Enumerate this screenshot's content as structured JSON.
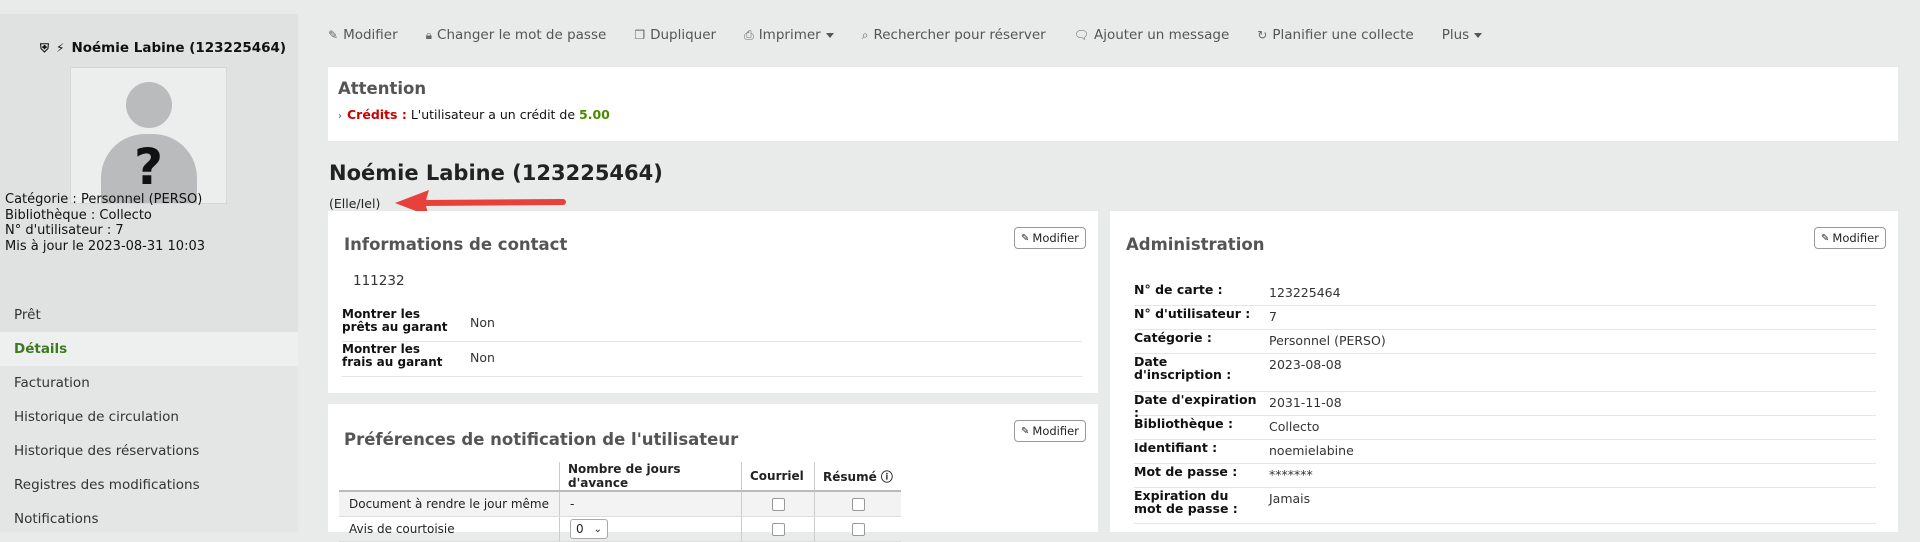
{
  "sidebar": {
    "patron_name": "Noémie Labine (123225464)",
    "info": [
      "Catégorie : Personnel (PERSO)",
      "Bibliothèque : Collecto",
      "N° d'utilisateur : 7",
      "Mis à jour le 2023-08-31 10:03"
    ],
    "nav": [
      "Prêt",
      "Détails",
      "Facturation",
      "Historique de circulation",
      "Historique des réservations",
      "Registres des modifications",
      "Notifications"
    ],
    "active_nav": "Détails"
  },
  "toolbar": {
    "items": [
      {
        "label": "Modifier",
        "icon": "pencil-icon"
      },
      {
        "label": "Changer le mot de passe",
        "icon": "lock-icon"
      },
      {
        "label": "Dupliquer",
        "icon": "copy-icon"
      },
      {
        "label": "Imprimer",
        "icon": "print-icon",
        "dropdown": true
      },
      {
        "label": "Rechercher pour réserver",
        "icon": "search-icon"
      },
      {
        "label": "Ajouter un message",
        "icon": "comment-icon"
      },
      {
        "label": "Planifier une collecte",
        "icon": "refresh-icon"
      },
      {
        "label": "Plus",
        "dropdown": true
      }
    ]
  },
  "attention": {
    "title": "Attention",
    "credit_label": "Crédits :",
    "credit_text": "L'utilisateur a un crédit de",
    "credit_value": "5.00"
  },
  "patron": {
    "heading": "Noémie Labine (123225464)",
    "pronouns": "(Elle/Iel)"
  },
  "contact": {
    "title": "Informations de contact",
    "edit_label": "Modifier",
    "phone": "111232",
    "rows": [
      {
        "key": "Montrer les prêts au garant",
        "value": "Non"
      },
      {
        "key": "Montrer les frais au garant",
        "value": "Non"
      }
    ]
  },
  "notifications": {
    "title": "Préférences de notification de l'utilisateur",
    "edit_label": "Modifier",
    "headers": [
      "",
      "Nombre de jours d'avance",
      "Courriel",
      "Résumé"
    ],
    "rows": [
      {
        "label": "Document à rendre le jour même",
        "days": "-"
      },
      {
        "label": "Avis de courtoisie",
        "days": "0"
      }
    ]
  },
  "admin": {
    "title": "Administration",
    "edit_label": "Modifier",
    "rows": [
      {
        "key": "N° de carte :",
        "value": "123225464"
      },
      {
        "key": "N° d'utilisateur :",
        "value": "7"
      },
      {
        "key": "Catégorie :",
        "value": "Personnel (PERSO)"
      },
      {
        "key": "Date d'inscription :",
        "value": "2023-08-08"
      },
      {
        "key": "Date d'expiration :",
        "value": "2031-11-08"
      },
      {
        "key": "Bibliothèque :",
        "value": "Collecto"
      },
      {
        "key": "Identifiant :",
        "value": "noemielabine"
      },
      {
        "key": "Mot de passe :",
        "value": "*******"
      },
      {
        "key": "Expiration du mot de passe :",
        "value": "Jamais"
      }
    ]
  },
  "colors": {
    "accent_green": "#3d7a22",
    "credit_red": "#cc0000",
    "arrow_red": "#e8403a"
  }
}
